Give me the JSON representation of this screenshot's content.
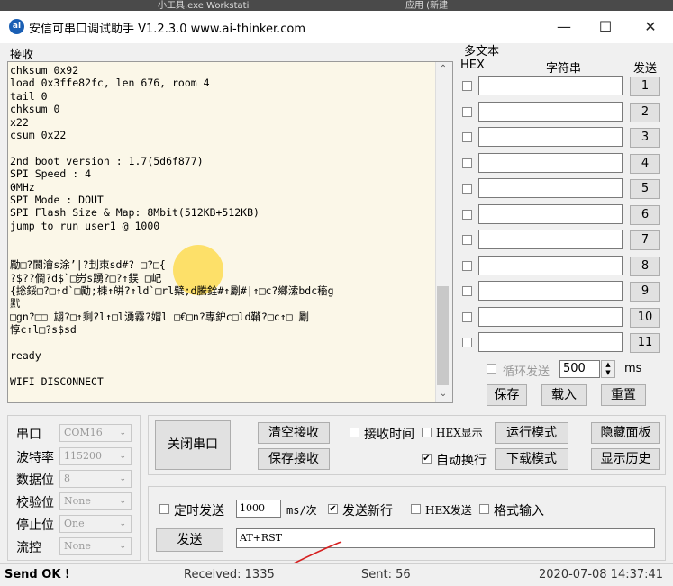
{
  "background_window": {
    "left_text": "小工具.exe  Workstati",
    "right_text": "应用 (新建"
  },
  "window": {
    "icon_text": "ai",
    "title": "安信可串口调试助手 V1.2.3.0   www.ai-thinker.com",
    "minimize_glyph": "—",
    "maximize_glyph": "☐",
    "close_glyph": "✕"
  },
  "receive": {
    "label": "接收",
    "text": "chksum 0x92\nload 0x3ffe82fc, len 676, room 4\ntail 0\nchksum 0\nx22\ncsum 0x22\n\n2nd boot version : 1.7(5d6f877)\nSPI Speed : 4\n0MHz\nSPI Mode : DOUT\nSPI Flash Size & Map: 8Mbit(512KB+512KB)\njump to run user1 @ 1000\n\n\n勵□?閬澮s涂’|?刲朿sd#? □?□{\n?$??僴?d$`□岃s踴?□?↑鋘 □屺\n{捴鋖□?□↑d`□勵;栜↑皏?↑ld`□rl檗;d騰銓#↑劚#|↑□c?鄉溹bdc稸g\n黓\n□gn?□□ 翃?□↑剩?l↑□l湧霧?媢l □€□n?専鈩c□ld鞘?□c↑□ 劚\n惇c↑l□?s$sd\n\nready\n\nWIFI DISCONNECT",
    "scroll_up_glyph": "⌃",
    "scroll_down_glyph": "⌄"
  },
  "multi": {
    "title": "多文本",
    "col_hex": "HEX",
    "col_string": "字符串",
    "col_send": "发送",
    "rows": [
      {
        "num": "1",
        "text": ""
      },
      {
        "num": "2",
        "text": ""
      },
      {
        "num": "3",
        "text": ""
      },
      {
        "num": "4",
        "text": ""
      },
      {
        "num": "5",
        "text": ""
      },
      {
        "num": "6",
        "text": ""
      },
      {
        "num": "7",
        "text": ""
      },
      {
        "num": "8",
        "text": ""
      },
      {
        "num": "9",
        "text": ""
      },
      {
        "num": "10",
        "text": ""
      },
      {
        "num": "11",
        "text": ""
      }
    ],
    "loop_label": "循环发送",
    "loop_value": "500",
    "loop_unit": "ms",
    "save_button": "保存",
    "load_button": "载入",
    "reset_button": "重置"
  },
  "serial": {
    "port_label": "串口",
    "port_value": "COM16",
    "baud_label": "波特率",
    "baud_value": "115200",
    "databits_label": "数据位",
    "databits_value": "8",
    "parity_label": "校验位",
    "parity_value": "None",
    "stopbits_label": "停止位",
    "stopbits_value": "One",
    "flow_label": "流控",
    "flow_value": "None",
    "combo_arrow": "⌄"
  },
  "controls": {
    "close_port_button": "关闭串口",
    "clear_receive_button": "清空接收",
    "save_receive_button": "保存接收",
    "recv_time_label": "接收时间",
    "hex_display_label": "HEX显示",
    "run_mode_button": "运行模式",
    "hide_panel_button": "隐藏面板",
    "auto_newline_label": "自动换行",
    "auto_newline_check": "✔",
    "download_mode_button": "下载模式",
    "show_history_button": "显示历史"
  },
  "send": {
    "timed_send_label": "定时发送",
    "interval_value": "1000",
    "interval_unit": "ms/次",
    "send_newline_label": "发送新行",
    "send_newline_check": "✔",
    "hex_send_label": "HEX发送",
    "format_input_label": "格式输入",
    "send_button": "发送",
    "send_text": "AT+RST"
  },
  "status": {
    "send_status": "Send OK !",
    "received": "Received: 1335",
    "sent": "Sent: 56",
    "datetime": "2020-07-08 14:37:41"
  }
}
